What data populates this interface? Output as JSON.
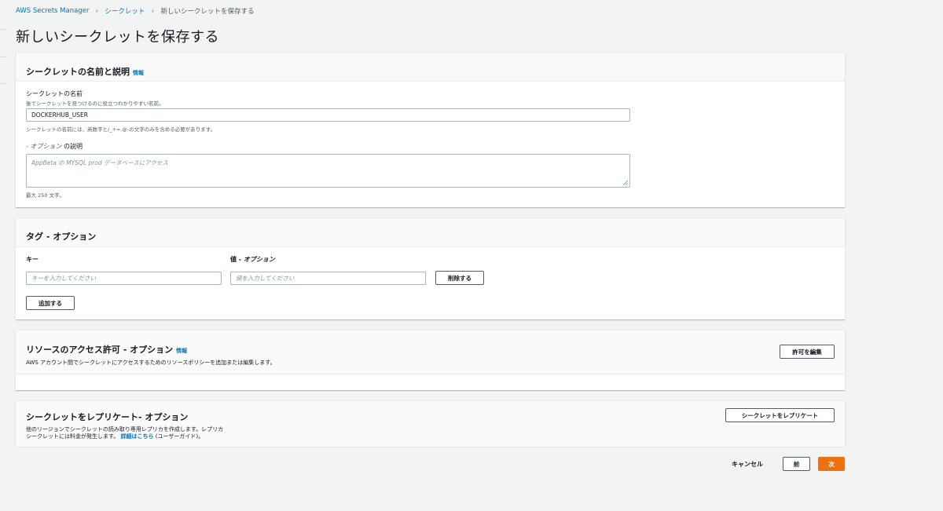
{
  "breadcrumb": {
    "root": "AWS Secrets Manager",
    "section": "シークレット",
    "current": "新しいシークレットを保存する"
  },
  "page_title": "新しいシークレットを保存する",
  "name_panel": {
    "title": "シークレットの名前と説明",
    "info": "情報",
    "name_label": "シークレットの名前",
    "name_hint": "後でシークレットを見つけるのに役立つわかりやすい名前。",
    "name_value": "DOCKERHUB_USER",
    "name_constraint": "シークレットの名前には、英数字と/_+=.@-の文字のみを含める必要があります。",
    "desc_label_opt": "- オプション",
    "desc_label": "の説明",
    "desc_placeholder": "AppBeta の MYSQL prod データベースにアクセス",
    "desc_limit": "最大 250 文字。"
  },
  "tags_panel": {
    "title": "タグ - オプション",
    "key_label": "キー",
    "value_label_prefix": "値 -",
    "value_label_opt": "オプション",
    "key_placeholder": "キーを入力してください",
    "value_placeholder": "値を入力してください",
    "remove_button": "削除する",
    "add_button": "追加する"
  },
  "resource_panel": {
    "title": "リソースのアクセス許可 - オプション",
    "info": "情報",
    "desc": "AWS アカウント間でシークレットにアクセスするためのリソースポリシーを追加または編集します。",
    "edit_button": "許可を編集"
  },
  "replicate_panel": {
    "title": "シークレットをレプリケート- オプション",
    "desc_line1": "他のリージョンでシークレットの読み取り専用レプリカを作成します。レプリカ",
    "desc_line2_prefix": "シークレットには料金が発生します。",
    "desc_link": "詳細はこちら",
    "desc_suffix": "(ユーザーガイド)。",
    "replicate_button": "シークレットをレプリケート"
  },
  "footer": {
    "cancel": "キャンセル",
    "previous": "前",
    "next": "次"
  },
  "colors": {
    "accent": "#ec7211",
    "link": "#0073bb",
    "background": "#f2f3f3"
  }
}
